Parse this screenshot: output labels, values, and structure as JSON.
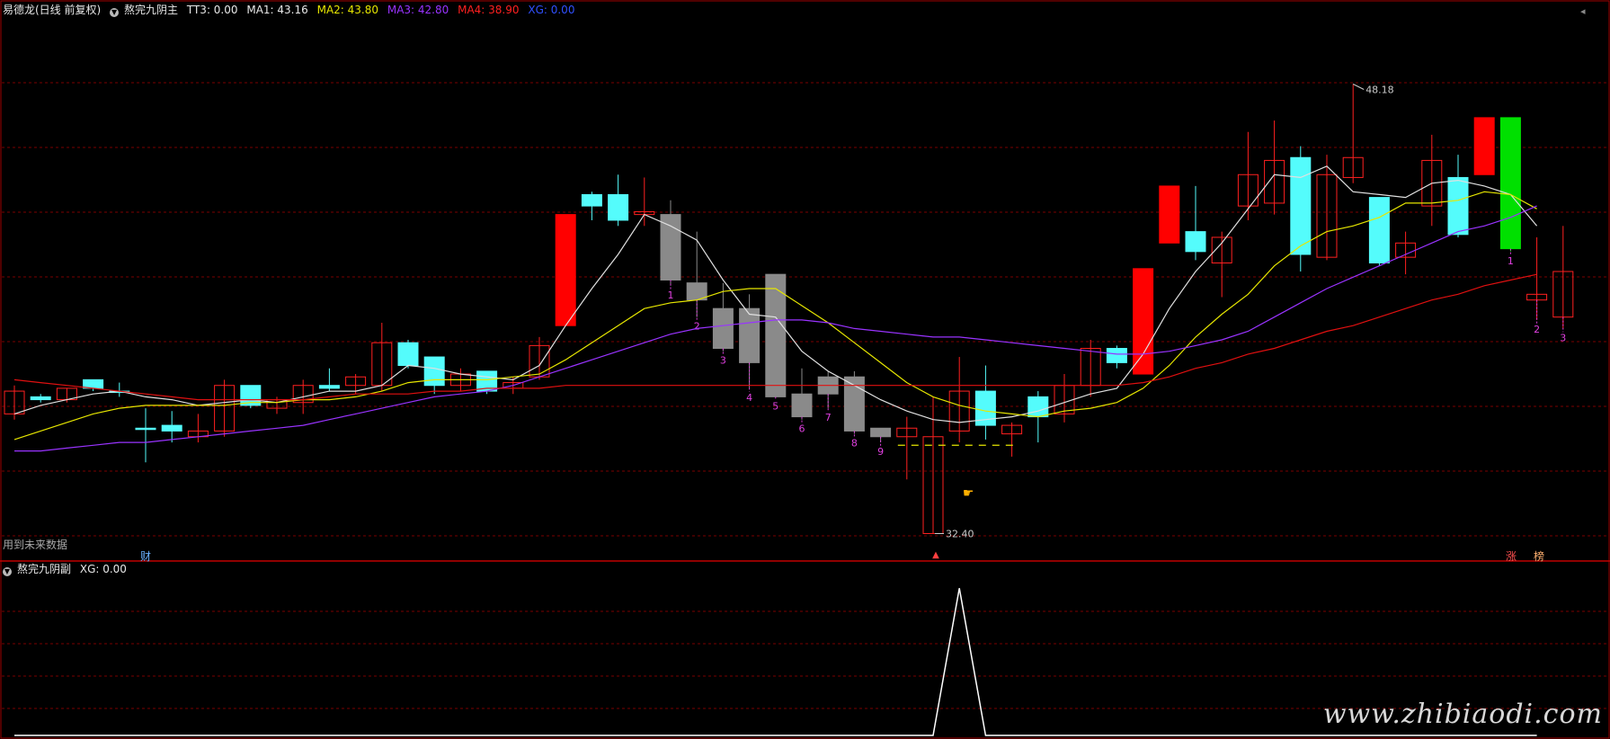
{
  "header_main": {
    "app": "易德龙(日线 前复权)",
    "indicator": "熬完九阴主",
    "tt3": "TT3: 0.00",
    "ma1": "MA1: 43.16",
    "ma2": "MA2: 43.80",
    "ma3": "MA3: 42.80",
    "ma4": "MA4: 38.90",
    "xg": "XG: 0.00"
  },
  "header_sub": {
    "indicator": "熬完九阴副",
    "xg": "XG: 0.00"
  },
  "notes": {
    "future_data": "用到未来数据",
    "badge_cai": "财",
    "badge_zhang": "涨",
    "badge_bang": "榜",
    "high_label": "48.18",
    "low_label": "32.40"
  },
  "watermark": "www.zhibiaodi.com",
  "colors": {
    "up": "#ff2020",
    "down": "#54fcfc",
    "grey": "#8a8a8a",
    "bigred": "#ff0000",
    "green": "#00e000",
    "ma1": "#e0e0e0",
    "ma2": "#e6e600",
    "ma3": "#9933ff",
    "ma4": "#e01010",
    "count": "#e040e0"
  },
  "chart_data": {
    "type": "candlestick",
    "ylim": [
      31.5,
      50.5
    ],
    "candles": [
      {
        "o": 36.6,
        "h": 37.6,
        "l": 36.4,
        "c": 37.4,
        "s": "up"
      },
      {
        "o": 37.2,
        "h": 37.3,
        "l": 37.0,
        "c": 37.1,
        "s": "down"
      },
      {
        "o": 37.1,
        "h": 37.5,
        "l": 37.0,
        "c": 37.5,
        "s": "up"
      },
      {
        "o": 37.8,
        "h": 37.8,
        "l": 37.4,
        "c": 37.5,
        "s": "down"
      },
      {
        "o": 37.4,
        "h": 37.7,
        "l": 37.2,
        "c": 37.4,
        "s": "down"
      },
      {
        "o": 36.1,
        "h": 36.8,
        "l": 34.9,
        "c": 36.1,
        "s": "down"
      },
      {
        "o": 36.2,
        "h": 36.7,
        "l": 35.6,
        "c": 36.0,
        "s": "down"
      },
      {
        "o": 35.8,
        "h": 36.6,
        "l": 35.6,
        "c": 36.0,
        "s": "up"
      },
      {
        "o": 36.0,
        "h": 37.8,
        "l": 35.8,
        "c": 37.6,
        "s": "up"
      },
      {
        "o": 37.6,
        "h": 37.6,
        "l": 36.8,
        "c": 36.9,
        "s": "down"
      },
      {
        "o": 36.8,
        "h": 37.2,
        "l": 36.6,
        "c": 37.1,
        "s": "up"
      },
      {
        "o": 37.0,
        "h": 37.8,
        "l": 36.6,
        "c": 37.6,
        "s": "up"
      },
      {
        "o": 37.6,
        "h": 38.2,
        "l": 37.4,
        "c": 37.5,
        "s": "down"
      },
      {
        "o": 37.6,
        "h": 38.0,
        "l": 37.3,
        "c": 37.9,
        "s": "up"
      },
      {
        "o": 37.6,
        "h": 39.8,
        "l": 37.4,
        "c": 39.1,
        "s": "up"
      },
      {
        "o": 39.1,
        "h": 39.2,
        "l": 38.2,
        "c": 38.3,
        "s": "down"
      },
      {
        "o": 38.6,
        "h": 38.6,
        "l": 37.3,
        "c": 37.6,
        "s": "down"
      },
      {
        "o": 37.6,
        "h": 38.2,
        "l": 37.4,
        "c": 38.0,
        "s": "up"
      },
      {
        "o": 38.1,
        "h": 38.1,
        "l": 37.3,
        "c": 37.4,
        "s": "down"
      },
      {
        "o": 37.5,
        "h": 37.9,
        "l": 37.3,
        "c": 37.7,
        "s": "up"
      },
      {
        "o": 37.9,
        "h": 39.3,
        "l": 37.8,
        "c": 39.0,
        "s": "up"
      },
      {
        "o": 39.7,
        "h": 39.7,
        "l": 39.7,
        "c": 43.6,
        "s": "bigred"
      },
      {
        "o": 43.9,
        "h": 44.4,
        "l": 43.4,
        "c": 44.3,
        "s": "down"
      },
      {
        "o": 44.3,
        "h": 45.0,
        "l": 43.2,
        "c": 43.4,
        "s": "down"
      },
      {
        "o": 43.6,
        "h": 44.9,
        "l": 43.2,
        "c": 43.7,
        "s": "up"
      },
      {
        "o": 43.6,
        "h": 44.1,
        "l": 41.1,
        "c": 41.3,
        "s": "grey",
        "n": "1"
      },
      {
        "o": 41.2,
        "h": 43.0,
        "l": 40.0,
        "c": 40.6,
        "s": "grey",
        "n": "2"
      },
      {
        "o": 40.3,
        "h": 41.2,
        "l": 38.8,
        "c": 38.9,
        "s": "grey",
        "n": "3"
      },
      {
        "o": 40.3,
        "h": 40.8,
        "l": 37.5,
        "c": 38.4,
        "s": "grey",
        "n": "4"
      },
      {
        "o": 41.5,
        "h": 41.5,
        "l": 37.2,
        "c": 37.2,
        "s": "grey",
        "n": "5"
      },
      {
        "o": 37.3,
        "h": 38.2,
        "l": 36.4,
        "c": 36.5,
        "s": "grey",
        "n": "6"
      },
      {
        "o": 37.9,
        "h": 38.1,
        "l": 36.8,
        "c": 37.3,
        "s": "grey",
        "n": "7"
      },
      {
        "o": 37.9,
        "h": 38.1,
        "l": 35.9,
        "c": 36.0,
        "s": "grey",
        "n": "8"
      },
      {
        "o": 36.1,
        "h": 36.1,
        "l": 35.6,
        "c": 35.8,
        "s": "grey",
        "n": "9"
      },
      {
        "o": 35.8,
        "h": 36.5,
        "l": 34.3,
        "c": 36.1,
        "s": "up"
      },
      {
        "o": 32.4,
        "h": 37.2,
        "l": 32.4,
        "c": 35.8,
        "s": "up"
      },
      {
        "o": 36.0,
        "h": 38.6,
        "l": 35.6,
        "c": 37.4,
        "s": "up"
      },
      {
        "o": 37.4,
        "h": 38.3,
        "l": 35.7,
        "c": 36.2,
        "s": "down"
      },
      {
        "o": 35.9,
        "h": 36.3,
        "l": 35.1,
        "c": 36.2,
        "s": "up"
      },
      {
        "o": 37.2,
        "h": 37.4,
        "l": 35.6,
        "c": 36.5,
        "s": "down"
      },
      {
        "o": 36.6,
        "h": 38.0,
        "l": 36.3,
        "c": 37.6,
        "s": "up"
      },
      {
        "o": 37.6,
        "h": 39.2,
        "l": 37.2,
        "c": 38.9,
        "s": "up"
      },
      {
        "o": 38.9,
        "h": 39.0,
        "l": 38.2,
        "c": 38.4,
        "s": "down"
      },
      {
        "o": 38.0,
        "h": 38.0,
        "l": 38.0,
        "c": 41.7,
        "s": "bigred"
      },
      {
        "o": 44.6,
        "h": 44.6,
        "l": 44.6,
        "c": 42.6,
        "s": "bigred"
      },
      {
        "o": 43.0,
        "h": 44.6,
        "l": 42.0,
        "c": 42.3,
        "s": "down"
      },
      {
        "o": 41.9,
        "h": 43.0,
        "l": 40.7,
        "c": 42.8,
        "s": "up"
      },
      {
        "o": 43.9,
        "h": 46.5,
        "l": 43.4,
        "c": 45.0,
        "s": "up"
      },
      {
        "o": 44.0,
        "h": 46.9,
        "l": 43.6,
        "c": 45.5,
        "s": "up"
      },
      {
        "o": 45.6,
        "h": 46.0,
        "l": 41.6,
        "c": 42.2,
        "s": "down"
      },
      {
        "o": 42.1,
        "h": 45.7,
        "l": 42.0,
        "c": 45.0,
        "s": "up"
      },
      {
        "o": 44.9,
        "h": 48.18,
        "l": 44.7,
        "c": 45.6,
        "s": "up"
      },
      {
        "o": 44.2,
        "h": 44.2,
        "l": 41.8,
        "c": 41.9,
        "s": "down"
      },
      {
        "o": 42.1,
        "h": 43.0,
        "l": 41.5,
        "c": 42.6,
        "s": "up"
      },
      {
        "o": 43.9,
        "h": 46.4,
        "l": 43.2,
        "c": 45.5,
        "s": "up"
      },
      {
        "o": 44.9,
        "h": 45.7,
        "l": 42.8,
        "c": 42.9,
        "s": "down"
      },
      {
        "o": 47.0,
        "h": 47.0,
        "l": 47.0,
        "c": 45.0,
        "s": "bigred"
      },
      {
        "o": 47.0,
        "h": 47.0,
        "l": 42.3,
        "c": 42.4,
        "s": "green",
        "n": "1"
      },
      {
        "o": 40.8,
        "h": 42.8,
        "l": 39.9,
        "c": 40.6,
        "s": "up",
        "n": "2"
      },
      {
        "o": 40.0,
        "h": 43.2,
        "l": 39.6,
        "c": 41.6,
        "s": "up",
        "n": "3"
      }
    ],
    "ma_lines": {
      "ma1": [
        36.6,
        36.9,
        37.1,
        37.3,
        37.4,
        37.2,
        37.1,
        36.9,
        37.0,
        37.1,
        37.0,
        37.2,
        37.4,
        37.4,
        37.6,
        38.3,
        38.2,
        38.0,
        37.9,
        37.8,
        38.3,
        39.7,
        41.0,
        42.2,
        43.6,
        43.2,
        42.7,
        41.3,
        40.1,
        40.0,
        38.8,
        38.1,
        37.6,
        37.1,
        36.7,
        36.4,
        36.3,
        36.4,
        36.5,
        36.7,
        37.0,
        37.3,
        37.5,
        38.7,
        40.3,
        41.6,
        42.6,
        43.8,
        45.0,
        44.9,
        45.3,
        44.4,
        44.3,
        44.2,
        44.7,
        44.8,
        44.6,
        44.3,
        43.2
      ],
      "ma2": [
        35.7,
        36.0,
        36.3,
        36.6,
        36.8,
        36.9,
        36.9,
        36.9,
        36.9,
        37.0,
        37.0,
        37.1,
        37.1,
        37.2,
        37.4,
        37.7,
        37.8,
        37.8,
        37.8,
        37.9,
        38.0,
        38.5,
        39.1,
        39.7,
        40.3,
        40.5,
        40.6,
        40.9,
        41.0,
        41.0,
        40.4,
        39.8,
        39.1,
        38.4,
        37.7,
        37.2,
        36.9,
        36.7,
        36.6,
        36.5,
        36.7,
        36.8,
        37.0,
        37.5,
        38.3,
        39.3,
        40.1,
        40.8,
        41.8,
        42.5,
        43.0,
        43.2,
        43.5,
        44.0,
        44.0,
        44.1,
        44.4,
        44.3,
        43.8
      ],
      "ma3": [
        35.3,
        35.3,
        35.4,
        35.5,
        35.6,
        35.6,
        35.7,
        35.8,
        35.9,
        36.0,
        36.1,
        36.2,
        36.4,
        36.6,
        36.8,
        37.0,
        37.2,
        37.3,
        37.4,
        37.6,
        37.9,
        38.2,
        38.5,
        38.8,
        39.1,
        39.4,
        39.6,
        39.7,
        39.8,
        39.9,
        39.9,
        39.8,
        39.6,
        39.5,
        39.4,
        39.3,
        39.3,
        39.2,
        39.1,
        39.0,
        38.9,
        38.8,
        38.7,
        38.7,
        38.8,
        39.0,
        39.2,
        39.5,
        40.0,
        40.5,
        41.0,
        41.4,
        41.8,
        42.2,
        42.6,
        43.0,
        43.2,
        43.5,
        43.9
      ],
      "ma4": [
        37.8,
        37.7,
        37.6,
        37.5,
        37.4,
        37.3,
        37.2,
        37.1,
        37.1,
        37.1,
        37.1,
        37.1,
        37.2,
        37.3,
        37.3,
        37.3,
        37.4,
        37.4,
        37.5,
        37.5,
        37.5,
        37.6,
        37.6,
        37.6,
        37.6,
        37.6,
        37.6,
        37.6,
        37.6,
        37.6,
        37.6,
        37.6,
        37.6,
        37.6,
        37.6,
        37.6,
        37.6,
        37.6,
        37.6,
        37.6,
        37.6,
        37.6,
        37.6,
        37.7,
        37.9,
        38.2,
        38.4,
        38.7,
        38.9,
        39.2,
        39.5,
        39.7,
        40.0,
        40.3,
        40.6,
        40.8,
        41.1,
        41.3,
        41.5
      ]
    },
    "sub": {
      "xg": [
        0,
        0,
        0,
        0,
        0,
        0,
        0,
        0,
        0,
        0,
        0,
        0,
        0,
        0,
        0,
        0,
        0,
        0,
        0,
        0,
        0,
        0,
        0,
        0,
        0,
        0,
        0,
        0,
        0,
        0,
        0,
        0,
        0,
        0,
        0,
        0,
        1,
        0,
        0,
        0,
        0,
        0,
        0,
        0,
        0,
        0,
        0,
        0,
        0,
        0,
        0,
        0,
        0,
        0,
        0,
        0,
        0,
        0,
        0
      ],
      "ylim": [
        0,
        1.05
      ]
    }
  }
}
